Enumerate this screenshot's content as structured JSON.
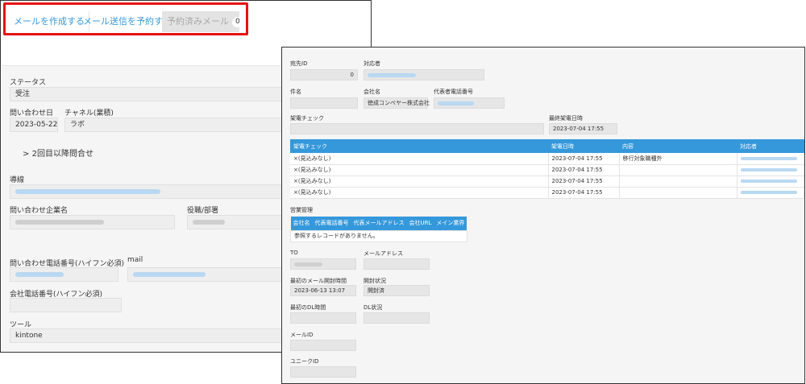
{
  "back": {
    "tabs": [
      {
        "label": "メールを作成する"
      },
      {
        "label": "メール送信を予約する"
      },
      {
        "label": "予約済みメール",
        "count": "0"
      }
    ],
    "status": {
      "label": "ステータス",
      "value": "受注"
    },
    "inquiry_date": {
      "label": "問い合わせ日",
      "value": "2023-05-22"
    },
    "channel": {
      "label": "チャネル(業積)",
      "value": "ラボ"
    },
    "accordion": {
      "label": "2回目以降問合せ"
    },
    "source": {
      "label": "導線"
    },
    "company": {
      "label": "問い合わせ企業名"
    },
    "position": {
      "label": "役職/部署"
    },
    "phone": {
      "label": "問い合わせ電話番号(ハイフン必須)"
    },
    "mail": {
      "label": "mail"
    },
    "company_phone": {
      "label": "会社電話番号(ハイフン必須)"
    },
    "tool": {
      "label": "ツール",
      "value": "kintone"
    }
  },
  "front": {
    "dest_id": {
      "label": "宛先ID",
      "value": "0"
    },
    "responder": {
      "label": "対応者"
    },
    "subject": {
      "label": "件名"
    },
    "company_name": {
      "label": "会社名",
      "value": "徳成コンベヤー株式会社"
    },
    "rep_phone": {
      "label": "代表者電話番号"
    },
    "call_check": {
      "label": "架電チェック"
    },
    "last_call": {
      "label": "最終架電日時",
      "value": "2023-07-04 17:55"
    },
    "call_table": {
      "headers": [
        "架電チェック",
        "架電日時",
        "内容",
        "対応者"
      ],
      "rows": [
        [
          "×(見込みなし)",
          "2023-07-04 17:55",
          "移行対象職種外"
        ],
        [
          "×(見込みなし)",
          "2023-07-04 17:55",
          ""
        ],
        [
          "×(見込みなし)",
          "2023-07-04 17:55",
          ""
        ],
        [
          "×(見込みなし)",
          "2023-07-04 17:55",
          ""
        ]
      ]
    },
    "sales": {
      "label": "営業管理",
      "headers": [
        "会社名",
        "代表電話番号",
        "代表メールアドレス",
        "会社URL",
        "メイン業界"
      ],
      "empty": "参照するレコードがありません。"
    },
    "to": {
      "label": "TO"
    },
    "mail_address": {
      "label": "メールアドレス"
    },
    "first_open": {
      "label": "最初のメール開封時間",
      "value": "2023-06-13 13:07"
    },
    "open_status": {
      "label": "開封状況",
      "value": "開封済"
    },
    "first_dl": {
      "label": "最初のDL時間"
    },
    "dl_status": {
      "label": "DL状況"
    },
    "mail_id": {
      "label": "メールID"
    },
    "unique_id": {
      "label": "ユニークID"
    }
  },
  "colors": {
    "accent": "#3498db",
    "highlight": "#e4130f"
  }
}
